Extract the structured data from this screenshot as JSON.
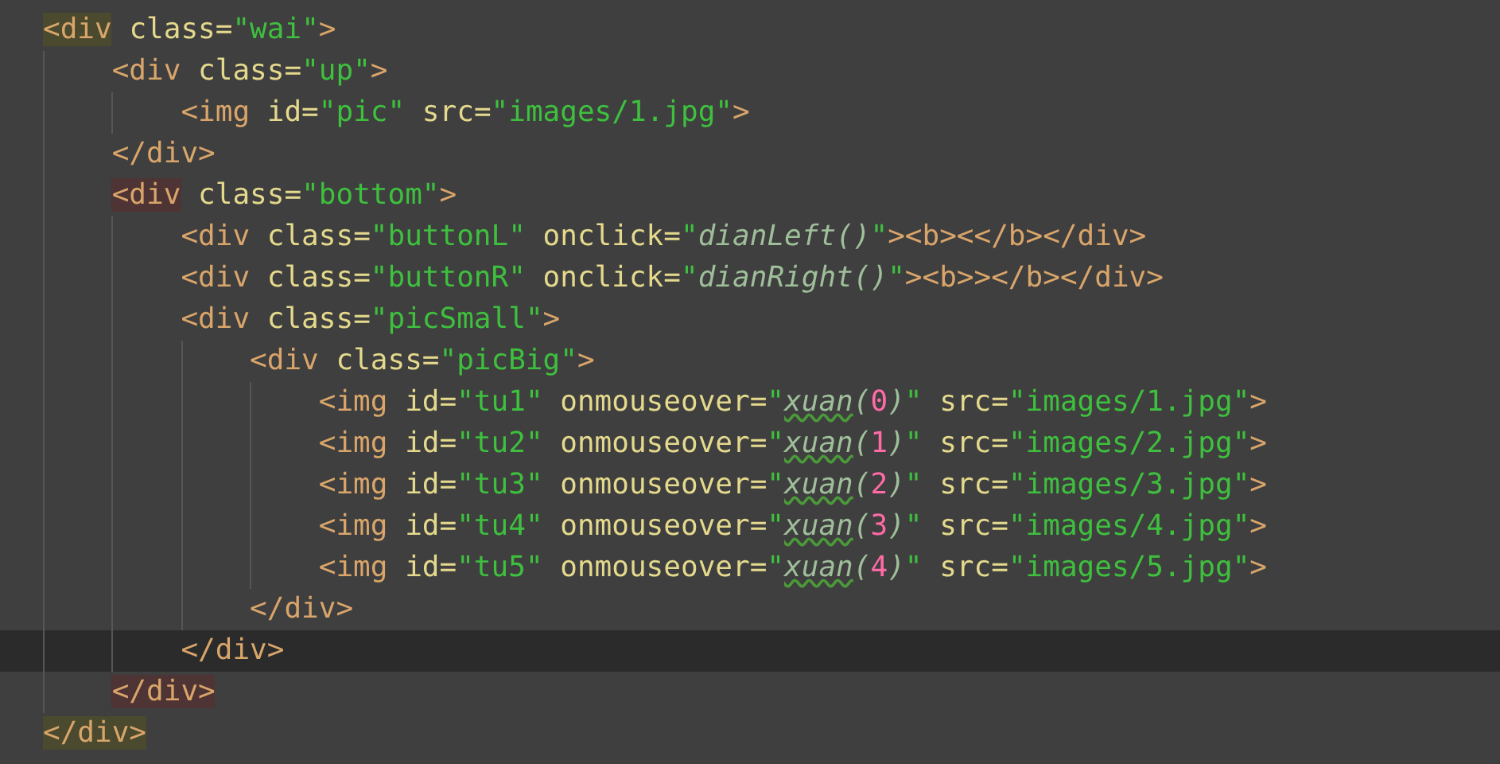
{
  "editor": {
    "lines": [
      {
        "current": false,
        "tokens": [
          {
            "kind": "tag",
            "text": "<div",
            "pair_highlighted": true,
            "cursor_inside": false
          },
          {
            "kind": "attr",
            "text": " class="
          },
          {
            "kind": "string",
            "text": "\"wai\""
          },
          {
            "kind": "tag",
            "text": ">"
          }
        ],
        "children": [
          {
            "current": false,
            "tokens": [
              {
                "kind": "tag",
                "text": "<div"
              },
              {
                "kind": "attr",
                "text": " class="
              },
              {
                "kind": "string",
                "text": "\"up\""
              },
              {
                "kind": "tag",
                "text": ">"
              }
            ],
            "children": [
              {
                "current": false,
                "tokens": [
                  {
                    "kind": "tag",
                    "text": "<img"
                  },
                  {
                    "kind": "attr",
                    "text": " id="
                  },
                  {
                    "kind": "string",
                    "text": "\"pic\""
                  },
                  {
                    "kind": "attr",
                    "text": " src="
                  },
                  {
                    "kind": "string",
                    "text": "\"images/1.jpg\""
                  },
                  {
                    "kind": "tag",
                    "text": ">"
                  }
                ]
              }
            ]
          },
          {
            "current": false,
            "tokens": [
              {
                "kind": "tag",
                "text": "</div>"
              }
            ]
          },
          {
            "current": false,
            "tokens": [
              {
                "kind": "tag",
                "text": "<div",
                "pair_highlighted": true,
                "cursor_inside": true
              },
              {
                "kind": "attr",
                "text": " class="
              },
              {
                "kind": "string",
                "text": "\"bottom\""
              },
              {
                "kind": "tag",
                "text": ">"
              }
            ],
            "children": [
              {
                "current": false,
                "tokens": [
                  {
                    "kind": "tag",
                    "text": "<div"
                  },
                  {
                    "kind": "attr",
                    "text": " class="
                  },
                  {
                    "kind": "string",
                    "text": "\"buttonL\""
                  },
                  {
                    "kind": "attr",
                    "text": " onclick="
                  },
                  {
                    "kind": "string",
                    "text": "\""
                  },
                  {
                    "kind": "js",
                    "text": "dianLeft()",
                    "misspelled": false
                  },
                  {
                    "kind": "string",
                    "text": "\""
                  },
                  {
                    "kind": "tag",
                    "text": "><b><</b></div>"
                  }
                ]
              },
              {
                "current": false,
                "tokens": [
                  {
                    "kind": "tag",
                    "text": "<div"
                  },
                  {
                    "kind": "attr",
                    "text": " class="
                  },
                  {
                    "kind": "string",
                    "text": "\"buttonR\""
                  },
                  {
                    "kind": "attr",
                    "text": " onclick="
                  },
                  {
                    "kind": "string",
                    "text": "\""
                  },
                  {
                    "kind": "js",
                    "text": "dianRight()",
                    "misspelled": false
                  },
                  {
                    "kind": "string",
                    "text": "\""
                  },
                  {
                    "kind": "tag",
                    "text": "><b>></b></div>"
                  }
                ]
              },
              {
                "current": false,
                "tokens": [
                  {
                    "kind": "tag",
                    "text": "<div"
                  },
                  {
                    "kind": "attr",
                    "text": " class="
                  },
                  {
                    "kind": "string",
                    "text": "\"picSmall\""
                  },
                  {
                    "kind": "tag",
                    "text": ">"
                  }
                ],
                "children": [
                  {
                    "current": false,
                    "tokens": [
                      {
                        "kind": "tag",
                        "text": "<div"
                      },
                      {
                        "kind": "attr",
                        "text": " class="
                      },
                      {
                        "kind": "string",
                        "text": "\"picBig\""
                      },
                      {
                        "kind": "tag",
                        "text": ">"
                      }
                    ],
                    "children": [
                      {
                        "current": false,
                        "tokens": [
                          {
                            "kind": "tag",
                            "text": "<img"
                          },
                          {
                            "kind": "attr",
                            "text": " id="
                          },
                          {
                            "kind": "string",
                            "text": "\"tu1\""
                          },
                          {
                            "kind": "attr",
                            "text": " onmouseover="
                          },
                          {
                            "kind": "string",
                            "text": "\""
                          },
                          {
                            "kind": "js",
                            "text": "xuan",
                            "misspelled": true
                          },
                          {
                            "kind": "js",
                            "text": "(",
                            "misspelled": false
                          },
                          {
                            "kind": "number",
                            "text": "0"
                          },
                          {
                            "kind": "js",
                            "text": ")",
                            "misspelled": false
                          },
                          {
                            "kind": "string",
                            "text": "\""
                          },
                          {
                            "kind": "attr",
                            "text": " src="
                          },
                          {
                            "kind": "string",
                            "text": "\"images/1.jpg\""
                          },
                          {
                            "kind": "tag",
                            "text": ">"
                          }
                        ]
                      },
                      {
                        "current": false,
                        "tokens": [
                          {
                            "kind": "tag",
                            "text": "<img"
                          },
                          {
                            "kind": "attr",
                            "text": " id="
                          },
                          {
                            "kind": "string",
                            "text": "\"tu2\""
                          },
                          {
                            "kind": "attr",
                            "text": " onmouseover="
                          },
                          {
                            "kind": "string",
                            "text": "\""
                          },
                          {
                            "kind": "js",
                            "text": "xuan",
                            "misspelled": true
                          },
                          {
                            "kind": "js",
                            "text": "(",
                            "misspelled": false
                          },
                          {
                            "kind": "number",
                            "text": "1"
                          },
                          {
                            "kind": "js",
                            "text": ")",
                            "misspelled": false
                          },
                          {
                            "kind": "string",
                            "text": "\""
                          },
                          {
                            "kind": "attr",
                            "text": " src="
                          },
                          {
                            "kind": "string",
                            "text": "\"images/2.jpg\""
                          },
                          {
                            "kind": "tag",
                            "text": ">"
                          }
                        ]
                      },
                      {
                        "current": false,
                        "tokens": [
                          {
                            "kind": "tag",
                            "text": "<img"
                          },
                          {
                            "kind": "attr",
                            "text": " id="
                          },
                          {
                            "kind": "string",
                            "text": "\"tu3\""
                          },
                          {
                            "kind": "attr",
                            "text": " onmouseover="
                          },
                          {
                            "kind": "string",
                            "text": "\""
                          },
                          {
                            "kind": "js",
                            "text": "xuan",
                            "misspelled": true
                          },
                          {
                            "kind": "js",
                            "text": "(",
                            "misspelled": false
                          },
                          {
                            "kind": "number",
                            "text": "2"
                          },
                          {
                            "kind": "js",
                            "text": ")",
                            "misspelled": false
                          },
                          {
                            "kind": "string",
                            "text": "\""
                          },
                          {
                            "kind": "attr",
                            "text": " src="
                          },
                          {
                            "kind": "string",
                            "text": "\"images/3.jpg\""
                          },
                          {
                            "kind": "tag",
                            "text": ">"
                          }
                        ]
                      },
                      {
                        "current": false,
                        "tokens": [
                          {
                            "kind": "tag",
                            "text": "<img"
                          },
                          {
                            "kind": "attr",
                            "text": " id="
                          },
                          {
                            "kind": "string",
                            "text": "\"tu4\""
                          },
                          {
                            "kind": "attr",
                            "text": " onmouseover="
                          },
                          {
                            "kind": "string",
                            "text": "\""
                          },
                          {
                            "kind": "js",
                            "text": "xuan",
                            "misspelled": true
                          },
                          {
                            "kind": "js",
                            "text": "(",
                            "misspelled": false
                          },
                          {
                            "kind": "number",
                            "text": "3"
                          },
                          {
                            "kind": "js",
                            "text": ")",
                            "misspelled": false
                          },
                          {
                            "kind": "string",
                            "text": "\""
                          },
                          {
                            "kind": "attr",
                            "text": " src="
                          },
                          {
                            "kind": "string",
                            "text": "\"images/4.jpg\""
                          },
                          {
                            "kind": "tag",
                            "text": ">"
                          }
                        ]
                      },
                      {
                        "current": false,
                        "tokens": [
                          {
                            "kind": "tag",
                            "text": "<img"
                          },
                          {
                            "kind": "attr",
                            "text": " id="
                          },
                          {
                            "kind": "string",
                            "text": "\"tu5\""
                          },
                          {
                            "kind": "attr",
                            "text": " onmouseover="
                          },
                          {
                            "kind": "string",
                            "text": "\""
                          },
                          {
                            "kind": "js",
                            "text": "xuan",
                            "misspelled": true
                          },
                          {
                            "kind": "js",
                            "text": "(",
                            "misspelled": false
                          },
                          {
                            "kind": "number",
                            "text": "4"
                          },
                          {
                            "kind": "js",
                            "text": ")",
                            "misspelled": false
                          },
                          {
                            "kind": "string",
                            "text": "\""
                          },
                          {
                            "kind": "attr",
                            "text": " src="
                          },
                          {
                            "kind": "string",
                            "text": "\"images/5.jpg\""
                          },
                          {
                            "kind": "tag",
                            "text": ">"
                          }
                        ]
                      }
                    ]
                  },
                  {
                    "current": false,
                    "tokens": [
                      {
                        "kind": "tag",
                        "text": "</div>"
                      }
                    ]
                  }
                ]
              },
              {
                "current": true,
                "tokens": [
                  {
                    "kind": "tag",
                    "text": "</div>"
                  }
                ]
              }
            ]
          },
          {
            "current": false,
            "tokens": [
              {
                "kind": "tag",
                "text": "</div>",
                "pair_highlighted": true,
                "cursor_inside": true
              }
            ]
          }
        ]
      },
      {
        "current": false,
        "tokens": [
          {
            "kind": "tag",
            "text": "</div>",
            "pair_highlighted": true,
            "cursor_inside": false
          }
        ]
      }
    ]
  }
}
